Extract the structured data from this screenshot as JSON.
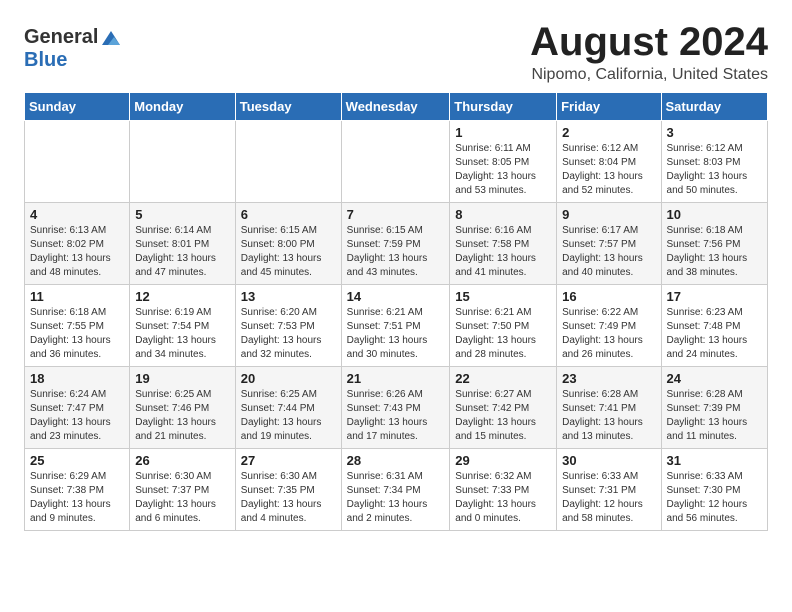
{
  "header": {
    "logo_general": "General",
    "logo_blue": "Blue",
    "title": "August 2024",
    "subtitle": "Nipomo, California, United States"
  },
  "days_of_week": [
    "Sunday",
    "Monday",
    "Tuesday",
    "Wednesday",
    "Thursday",
    "Friday",
    "Saturday"
  ],
  "weeks": [
    [
      {
        "day": "",
        "info": ""
      },
      {
        "day": "",
        "info": ""
      },
      {
        "day": "",
        "info": ""
      },
      {
        "day": "",
        "info": ""
      },
      {
        "day": "1",
        "info": "Sunrise: 6:11 AM\nSunset: 8:05 PM\nDaylight: 13 hours\nand 53 minutes."
      },
      {
        "day": "2",
        "info": "Sunrise: 6:12 AM\nSunset: 8:04 PM\nDaylight: 13 hours\nand 52 minutes."
      },
      {
        "day": "3",
        "info": "Sunrise: 6:12 AM\nSunset: 8:03 PM\nDaylight: 13 hours\nand 50 minutes."
      }
    ],
    [
      {
        "day": "4",
        "info": "Sunrise: 6:13 AM\nSunset: 8:02 PM\nDaylight: 13 hours\nand 48 minutes."
      },
      {
        "day": "5",
        "info": "Sunrise: 6:14 AM\nSunset: 8:01 PM\nDaylight: 13 hours\nand 47 minutes."
      },
      {
        "day": "6",
        "info": "Sunrise: 6:15 AM\nSunset: 8:00 PM\nDaylight: 13 hours\nand 45 minutes."
      },
      {
        "day": "7",
        "info": "Sunrise: 6:15 AM\nSunset: 7:59 PM\nDaylight: 13 hours\nand 43 minutes."
      },
      {
        "day": "8",
        "info": "Sunrise: 6:16 AM\nSunset: 7:58 PM\nDaylight: 13 hours\nand 41 minutes."
      },
      {
        "day": "9",
        "info": "Sunrise: 6:17 AM\nSunset: 7:57 PM\nDaylight: 13 hours\nand 40 minutes."
      },
      {
        "day": "10",
        "info": "Sunrise: 6:18 AM\nSunset: 7:56 PM\nDaylight: 13 hours\nand 38 minutes."
      }
    ],
    [
      {
        "day": "11",
        "info": "Sunrise: 6:18 AM\nSunset: 7:55 PM\nDaylight: 13 hours\nand 36 minutes."
      },
      {
        "day": "12",
        "info": "Sunrise: 6:19 AM\nSunset: 7:54 PM\nDaylight: 13 hours\nand 34 minutes."
      },
      {
        "day": "13",
        "info": "Sunrise: 6:20 AM\nSunset: 7:53 PM\nDaylight: 13 hours\nand 32 minutes."
      },
      {
        "day": "14",
        "info": "Sunrise: 6:21 AM\nSunset: 7:51 PM\nDaylight: 13 hours\nand 30 minutes."
      },
      {
        "day": "15",
        "info": "Sunrise: 6:21 AM\nSunset: 7:50 PM\nDaylight: 13 hours\nand 28 minutes."
      },
      {
        "day": "16",
        "info": "Sunrise: 6:22 AM\nSunset: 7:49 PM\nDaylight: 13 hours\nand 26 minutes."
      },
      {
        "day": "17",
        "info": "Sunrise: 6:23 AM\nSunset: 7:48 PM\nDaylight: 13 hours\nand 24 minutes."
      }
    ],
    [
      {
        "day": "18",
        "info": "Sunrise: 6:24 AM\nSunset: 7:47 PM\nDaylight: 13 hours\nand 23 minutes."
      },
      {
        "day": "19",
        "info": "Sunrise: 6:25 AM\nSunset: 7:46 PM\nDaylight: 13 hours\nand 21 minutes."
      },
      {
        "day": "20",
        "info": "Sunrise: 6:25 AM\nSunset: 7:44 PM\nDaylight: 13 hours\nand 19 minutes."
      },
      {
        "day": "21",
        "info": "Sunrise: 6:26 AM\nSunset: 7:43 PM\nDaylight: 13 hours\nand 17 minutes."
      },
      {
        "day": "22",
        "info": "Sunrise: 6:27 AM\nSunset: 7:42 PM\nDaylight: 13 hours\nand 15 minutes."
      },
      {
        "day": "23",
        "info": "Sunrise: 6:28 AM\nSunset: 7:41 PM\nDaylight: 13 hours\nand 13 minutes."
      },
      {
        "day": "24",
        "info": "Sunrise: 6:28 AM\nSunset: 7:39 PM\nDaylight: 13 hours\nand 11 minutes."
      }
    ],
    [
      {
        "day": "25",
        "info": "Sunrise: 6:29 AM\nSunset: 7:38 PM\nDaylight: 13 hours\nand 9 minutes."
      },
      {
        "day": "26",
        "info": "Sunrise: 6:30 AM\nSunset: 7:37 PM\nDaylight: 13 hours\nand 6 minutes."
      },
      {
        "day": "27",
        "info": "Sunrise: 6:30 AM\nSunset: 7:35 PM\nDaylight: 13 hours\nand 4 minutes."
      },
      {
        "day": "28",
        "info": "Sunrise: 6:31 AM\nSunset: 7:34 PM\nDaylight: 13 hours\nand 2 minutes."
      },
      {
        "day": "29",
        "info": "Sunrise: 6:32 AM\nSunset: 7:33 PM\nDaylight: 13 hours\nand 0 minutes."
      },
      {
        "day": "30",
        "info": "Sunrise: 6:33 AM\nSunset: 7:31 PM\nDaylight: 12 hours\nand 58 minutes."
      },
      {
        "day": "31",
        "info": "Sunrise: 6:33 AM\nSunset: 7:30 PM\nDaylight: 12 hours\nand 56 minutes."
      }
    ]
  ]
}
